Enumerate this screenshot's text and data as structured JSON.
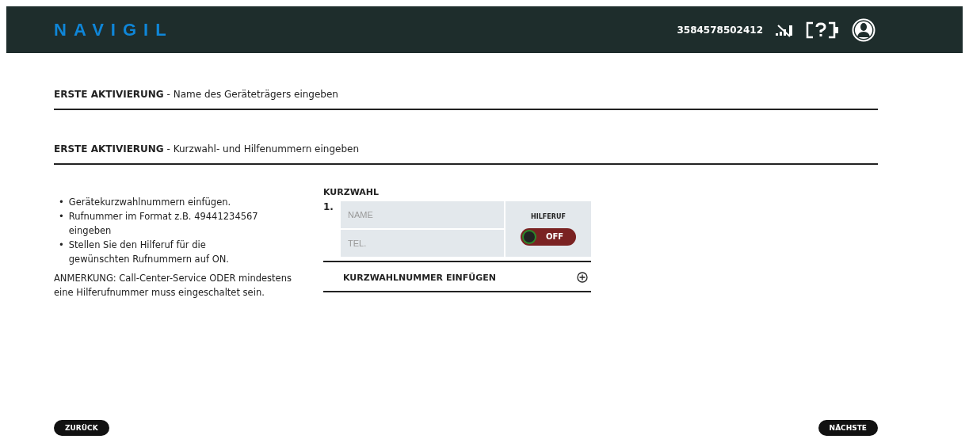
{
  "header": {
    "logo": "NAVIGIL",
    "phone": "3584578502412"
  },
  "sections": [
    {
      "title": "**ERSTE AKTIVIERUNG** - Name des Geräteträgers eingeben"
    },
    {
      "title": "**ERSTE AKTIVIERUNG** - Kurzwahl- und Hilfenummern eingeben"
    }
  ],
  "instructions": [
    {
      "bullet": "•",
      "text": "Gerätekurzwahlnummern einfügen."
    },
    {
      "bullet": "•",
      "text": "Rufnummer im Format z.B. 49441234567 eingeben"
    },
    {
      "bullet": "•",
      "text": "Stellen Sie den Hilferuf für die gewünschten Rufnummern auf ON."
    }
  ],
  "note": "ANMERKUNG: Call-Center-Service ODER mindestens eine Hilferufnummer muss eingeschaltet sein.",
  "speed_dial": {
    "title": "KURZWAHL",
    "entries": [
      {
        "number": "1.",
        "name_placeholder": "NAME",
        "tel_placeholder": "TEL.",
        "help_label": "HILFERUF",
        "help_call": {
          "on": false,
          "label": "OFF"
        }
      }
    ],
    "add_label": "KURZWAHLNUMMER EINFÜGEN"
  },
  "buttons": {
    "back": "ZURÜCK",
    "next": "NÄCHSTE"
  }
}
